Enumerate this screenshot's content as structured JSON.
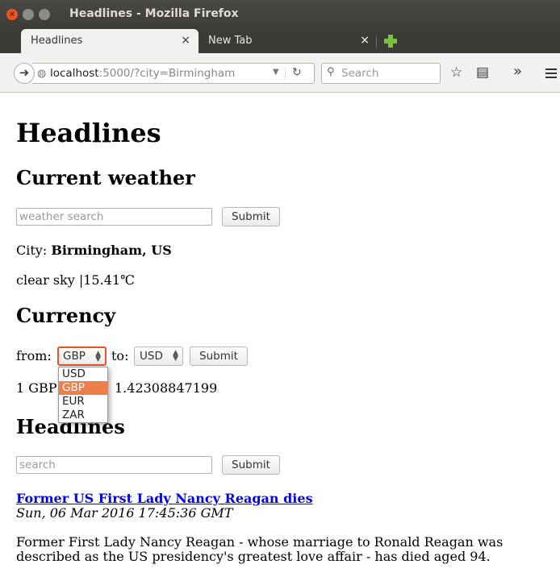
{
  "window": {
    "title": "Headlines - Mozilla Firefox"
  },
  "tabs": [
    {
      "label": "Headlines",
      "active": true
    },
    {
      "label": "New Tab",
      "active": false
    }
  ],
  "navbar": {
    "url_host": "localhost",
    "url_rest": ":5000/?city=Birmingham",
    "search_placeholder": "Search"
  },
  "page": {
    "title": "Headlines",
    "weather": {
      "heading": "Current weather",
      "search_placeholder": "weather search",
      "submit_label": "Submit",
      "city_label": "City:",
      "city_value": "Birmingham, US",
      "description": "clear sky |15.41℃"
    },
    "currency": {
      "heading": "Currency",
      "from_label": "from:",
      "from_value": "GBP",
      "to_label": "to:",
      "to_value": "USD",
      "submit_label": "Submit",
      "options": [
        "USD",
        "GBP",
        "EUR",
        "ZAR"
      ],
      "rate_prefix": "1 GBP",
      "rate_value": "1.42308847199"
    },
    "headlines": {
      "heading": "Headlines",
      "search_placeholder": "search",
      "submit_label": "Submit",
      "article": {
        "title": "Former US First Lady Nancy Reagan dies",
        "date": "Sun, 06 Mar 2016 17:45:36 GMT",
        "summary": "Former First Lady Nancy Reagan - whose marriage to Ronald Reagan was described as the US presidency's greatest love affair - has died aged 94."
      }
    }
  },
  "colors": {
    "accent": "#e95420",
    "selected_option": "#ee7e4a",
    "link": "#0000ee"
  }
}
